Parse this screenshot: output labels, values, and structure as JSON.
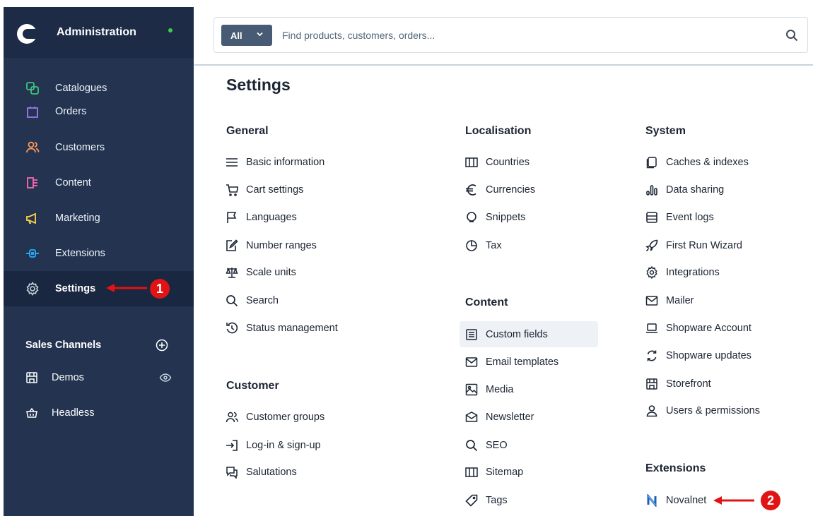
{
  "sidebar": {
    "title": "Administration",
    "nav": [
      {
        "label": "Catalogues",
        "icon": "catalogues-icon",
        "color": "#3fc47d"
      },
      {
        "label": "Orders",
        "icon": "orders-icon",
        "color": "#9b7bf2"
      },
      {
        "label": "Customers",
        "icon": "customers-icon",
        "color": "#ff9a5b"
      },
      {
        "label": "Content",
        "icon": "content-icon",
        "color": "#ff68b4"
      },
      {
        "label": "Marketing",
        "icon": "marketing-icon",
        "color": "#ffd34d"
      },
      {
        "label": "Extensions",
        "icon": "extensions-icon",
        "color": "#27b1ff"
      },
      {
        "label": "Settings",
        "icon": "settings-icon",
        "color": "#c8d2de"
      }
    ],
    "sales_channels": {
      "title": "Sales Channels",
      "items": [
        {
          "label": "Demos",
          "icon": "storefront-icon"
        },
        {
          "label": "Headless",
          "icon": "basket-icon"
        }
      ]
    }
  },
  "search": {
    "type_label": "All",
    "placeholder": "Find products, customers, orders..."
  },
  "page": {
    "title": "Settings"
  },
  "sections": {
    "general": {
      "title": "General",
      "items": [
        "Basic information",
        "Cart settings",
        "Languages",
        "Number ranges",
        "Scale units",
        "Search",
        "Status management"
      ]
    },
    "customer": {
      "title": "Customer",
      "items": [
        "Customer groups",
        "Log-in & sign-up",
        "Salutations"
      ]
    },
    "localisation": {
      "title": "Localisation",
      "items": [
        "Countries",
        "Currencies",
        "Snippets",
        "Tax"
      ]
    },
    "content": {
      "title": "Content",
      "items": [
        "Custom fields",
        "Email templates",
        "Media",
        "Newsletter",
        "SEO",
        "Sitemap",
        "Tags"
      ]
    },
    "system": {
      "title": "System",
      "items": [
        "Caches & indexes",
        "Data sharing",
        "Event logs",
        "First Run Wizard",
        "Integrations",
        "Mailer",
        "Shopware Account",
        "Shopware updates",
        "Storefront",
        "Users & permissions"
      ]
    },
    "extensions": {
      "title": "Extensions",
      "items": [
        "Novalnet"
      ]
    }
  },
  "annotations": {
    "step1": "1",
    "step2": "2",
    "color": "#e01414"
  }
}
